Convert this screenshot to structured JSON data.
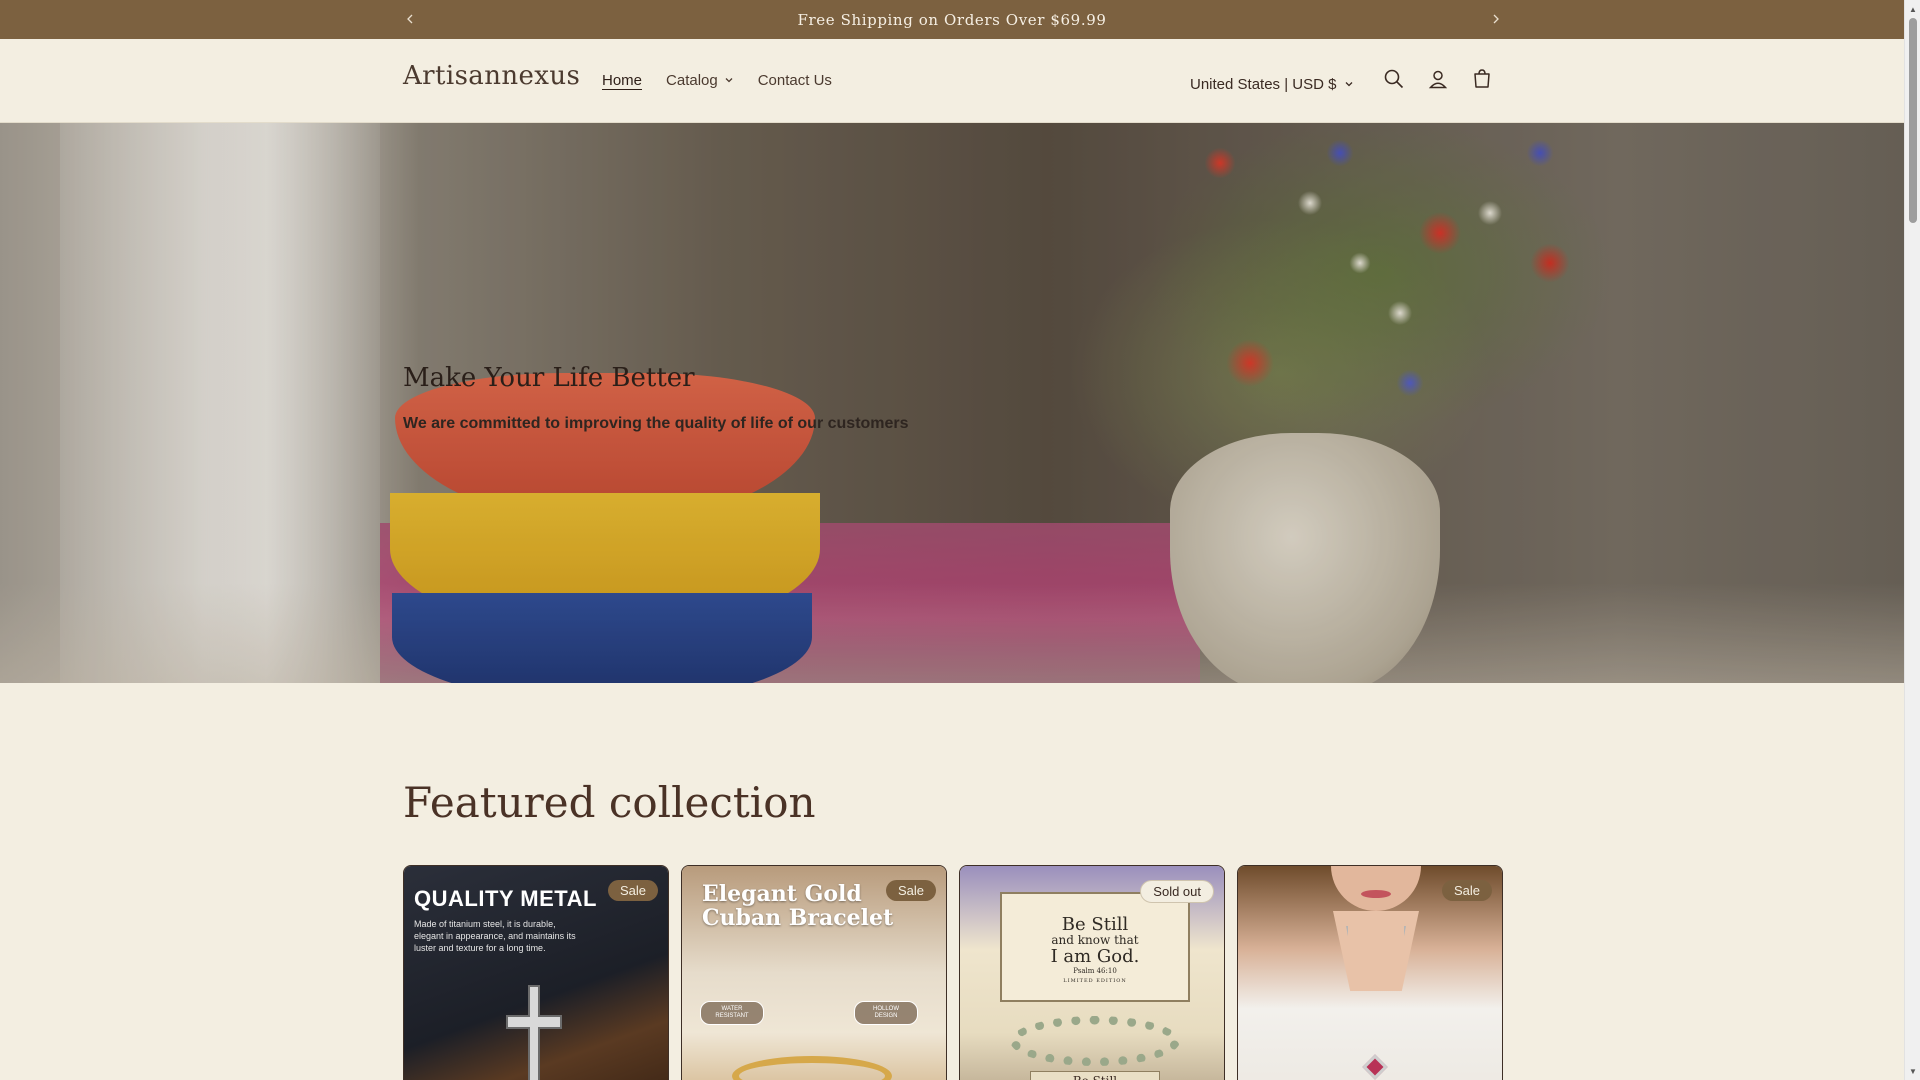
{
  "announcement": {
    "message": "Free Shipping on Orders Over $69.99",
    "prev_icon": "chevron-left-icon",
    "next_icon": "chevron-right-icon"
  },
  "header": {
    "logo": "Artisannexus",
    "nav": [
      {
        "label": "Home",
        "active": true
      },
      {
        "label": "Catalog",
        "has_dropdown": true
      },
      {
        "label": "Contact Us"
      }
    ],
    "country_selector": "United States | USD $",
    "icons": [
      "search-icon",
      "account-icon",
      "cart-icon"
    ]
  },
  "hero": {
    "title": "Make Your Life Better",
    "subtitle": "We are committed to improving the quality of life of our customers"
  },
  "featured": {
    "title": "Featured collection",
    "products": [
      {
        "badge": "Sale",
        "image_heading": "QUALITY METAL",
        "image_text": "Made of titanium steel, it is durable, elegant in appearance, and maintains its luster and texture for a long time."
      },
      {
        "badge": "Sale",
        "image_heading": "Elegant Gold Cuban Bracelet",
        "chip_left": "WATER RESISTANT",
        "chip_right": "HOLLOW DESIGN"
      },
      {
        "badge": "Sold out",
        "box_line1": "Be Still",
        "box_line2": "and know that",
        "box_line3": "I am God.",
        "box_line4": "Psalm 46:10",
        "box_line5": "LIMITED EDITION",
        "base_text": "Be Still"
      },
      {
        "badge": "Sale"
      }
    ]
  },
  "colors": {
    "announcement_bg": "#7c6140",
    "page_bg": "#f3eee1",
    "text": "#3a2a22"
  }
}
